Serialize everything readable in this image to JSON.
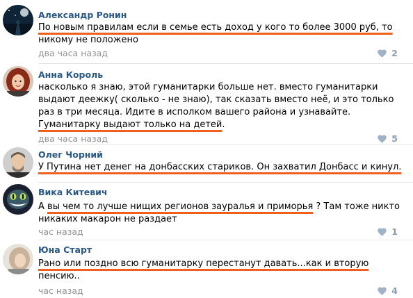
{
  "colors": {
    "author": "#2a5885",
    "meta": "#939393",
    "underline": "#f0601c",
    "like_icon": "#a0b2c6",
    "divider": "#e7e8ec"
  },
  "comments": [
    {
      "author": "Александр Ронин",
      "avatar": "night-scene-avatar",
      "lines": [
        [
          {
            "t": "По новым правилам если в семье есть доход у кого то более 3000 руб, то",
            "u": true
          }
        ],
        [
          {
            "t": "никому не положено",
            "u": false
          }
        ]
      ],
      "time": "два часа назад",
      "likes": "2"
    },
    {
      "author": "Анна Король",
      "avatar": "woman-red-hair-avatar",
      "lines": [
        [
          {
            "t": "насколько я знаю, этой гуманитарки больше нет. вместо гуманитарки",
            "u": false
          }
        ],
        [
          {
            "t": "выдают деежку( сколько - не знаю), так сказать вместо неё, и это только",
            "u": false
          }
        ],
        [
          {
            "t": "раз в три месяца. Идите в исполком вашего района и узнавайте.",
            "u": false
          }
        ],
        [
          {
            "t": "Гуманитарку выдают только на детей",
            "u": true
          },
          {
            "t": ".",
            "u": false
          }
        ]
      ],
      "time": "два часа назад",
      "likes": "5"
    },
    {
      "author": "Олег Чорний",
      "avatar": "man-beard-avatar",
      "lines": [
        [
          {
            "t": "У Путина нет денег на донбасских стариков. Он захватил Донбасс и кинул.",
            "u": true
          }
        ]
      ],
      "time": "",
      "likes": ""
    },
    {
      "author": "Вика Китевич",
      "avatar": "cheshire-cat-avatar",
      "lines": [
        [
          {
            "t": "А ",
            "u": false
          },
          {
            "t": "вы чем то лучше нищих регионов зауралья и приморья",
            "u": true
          },
          {
            "t": " ? Там тоже никто",
            "u": false
          }
        ],
        [
          {
            "t": "никаких макарон не раздает",
            "u": false
          }
        ]
      ],
      "time": "час назад",
      "likes": "1"
    },
    {
      "author": "Юна Старт",
      "avatar": "woman-profile-avatar",
      "lines": [
        [
          {
            "t": "Рано или поздно всю гуманитарку перестанут давать",
            "u": true
          },
          {
            "t": "...как и вторую",
            "u": true
          }
        ],
        [
          {
            "t": "пенсию..",
            "u": false
          }
        ]
      ],
      "time": "час назад",
      "likes": "4"
    }
  ]
}
